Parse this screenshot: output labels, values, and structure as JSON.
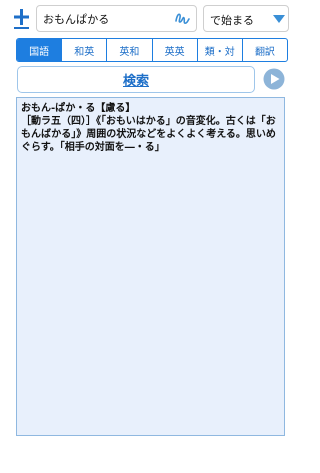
{
  "toolbar": {
    "add_icon": "plus-icon",
    "handwriting_icon": "handwriting-icon",
    "accent_color": "#1e7ee0"
  },
  "search": {
    "value": "おもんぱかる"
  },
  "mode": {
    "selected": "で始まる"
  },
  "dictionary_tabs": [
    {
      "label": "国語",
      "active": true
    },
    {
      "label": "和英",
      "active": false
    },
    {
      "label": "英和",
      "active": false
    },
    {
      "label": "英英",
      "active": false
    },
    {
      "label": "類・対",
      "active": false
    },
    {
      "label": "翻訳",
      "active": false
    }
  ],
  "actions": {
    "search_label": "検索",
    "play_icon": "play-icon"
  },
  "result": {
    "text": "おもん-ぱか・る【慮る】\n［動ラ五（四）］《「おもいはかる」の音変化。古くは「おもんばかる」》周囲の状況などをよくよく考える。思いめぐらす。「相手の対面を―・る」",
    "background": "#e8f0fc"
  }
}
